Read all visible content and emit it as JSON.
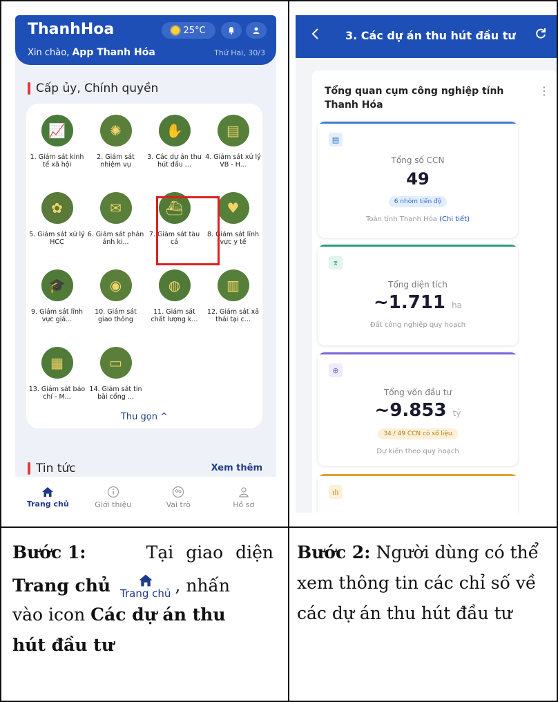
{
  "screen1": {
    "brand": "ThanhHoa",
    "temperature": "25°C",
    "greeting_prefix": "Xin chào,",
    "greeting_name": "App Thanh Hóa",
    "date": "Thứ Hai, 30/3",
    "section_title": "Cấp ủy, Chính quyền",
    "apps": [
      {
        "label": "1. Giám sát kinh tế xã hội",
        "icon": "growth-chart-icon",
        "bg": "#4a7a3a"
      },
      {
        "label": "2. Giám sát nhiệm vụ",
        "icon": "coin-gear-icon",
        "bg": "#5a7f3a"
      },
      {
        "label": "3. Các dự án thu hút đầu ...",
        "icon": "hand-coin-icon",
        "bg": "#4f7a38"
      },
      {
        "label": "4. Giám sát xử lý VB - H...",
        "icon": "document-icon",
        "bg": "#567f3a"
      },
      {
        "label": "5. Giám sát xử lý HCC",
        "icon": "flower-icon",
        "bg": "#5a7a3a"
      },
      {
        "label": "6. Giám sát phản ánh ki...",
        "icon": "envelope-icon",
        "bg": "#5a7f3a"
      },
      {
        "label": "7. Giám sát tàu cá",
        "icon": "ship-icon",
        "bg": "#4f7a38"
      },
      {
        "label": "8. Giám sát lĩnh vực y tế",
        "icon": "heartbeat-icon",
        "bg": "#567f3a"
      },
      {
        "label": "9. Giám sát lĩnh vực giá...",
        "icon": "graduation-cap-icon",
        "bg": "#4f7a38"
      },
      {
        "label": "10. Giám sát giao thông",
        "icon": "camera-icon",
        "bg": "#5a7f3a"
      },
      {
        "label": "11. Giám sát chất lượng k...",
        "icon": "globe-icon",
        "bg": "#4f7a38"
      },
      {
        "label": "12. Giám sát xả thải tại c...",
        "icon": "factory-icon",
        "bg": "#567f3a"
      },
      {
        "label": "13. Giám sát báo chí - M...",
        "icon": "newspaper-icon",
        "bg": "#4f7a38"
      },
      {
        "label": "14. Giám sát tin bài cổng ...",
        "icon": "monitor-icon",
        "bg": "#5a7f3a"
      }
    ],
    "collapse_label": "Thu gọn ^",
    "news_title": "Tin tức",
    "news_more": "Xem thêm",
    "nav": [
      {
        "label": "Trang chủ",
        "icon": "home-icon"
      },
      {
        "label": "Giới thiệu",
        "icon": "info-icon"
      },
      {
        "label": "Vai trò",
        "icon": "roles-icon"
      },
      {
        "label": "Hồ sơ",
        "icon": "profile-icon"
      }
    ]
  },
  "screen2": {
    "title": "3. Các dự án thu hút đầu tư",
    "panel_title": "Tổng quan cụm công nghiệp tỉnh Thanh Hóa",
    "stats": [
      {
        "label": "Tổng số CCN",
        "value": "49",
        "unit": "",
        "badge": "6 nhóm tiến độ",
        "foot": "Toàn tỉnh Thanh Hóa",
        "foot_link": "(Chi tiết)",
        "accent": "#3b7dd8",
        "badge_bg": "#e3eefc",
        "badge_fg": "#2d6cc4"
      },
      {
        "label": "Tổng diện tích",
        "value": "~1.711",
        "unit": "ha",
        "badge": "",
        "foot": "Đất công nghiệp quy hoạch",
        "foot_link": "",
        "accent": "#2e9b6e",
        "badge_bg": "",
        "badge_fg": ""
      },
      {
        "label": "Tổng vốn đầu tư",
        "value": "~9.853",
        "unit": "tỷ",
        "badge": "34 / 49 CCN có số liệu",
        "foot": "Dự kiến theo quy hoạch",
        "foot_link": "",
        "accent": "#7b61d9",
        "badge_bg": "#fdf0d8",
        "badge_fg": "#b77d14"
      },
      {
        "label": "",
        "value": "",
        "unit": "",
        "badge": "",
        "foot": "",
        "foot_link": "",
        "accent": "#e0a030",
        "badge_bg": "",
        "badge_fg": ""
      }
    ]
  },
  "captions": {
    "step1_label": "Bước 1:",
    "step1_text_a": "Tại giao diện",
    "step1_bold_home": "Trang chủ",
    "step1_icon_label": "Trang chủ",
    "step1_text_b": ", nhấn",
    "step1_text_c": "vào icon",
    "step1_bold_target_a": "Các dự án thu",
    "step1_bold_target_b": "hút đầu tư",
    "step2_label": "Bước 2:",
    "step2_text": "Người dùng có thể xem thông tin các chỉ số về các dự án thu hút đầu tư"
  }
}
